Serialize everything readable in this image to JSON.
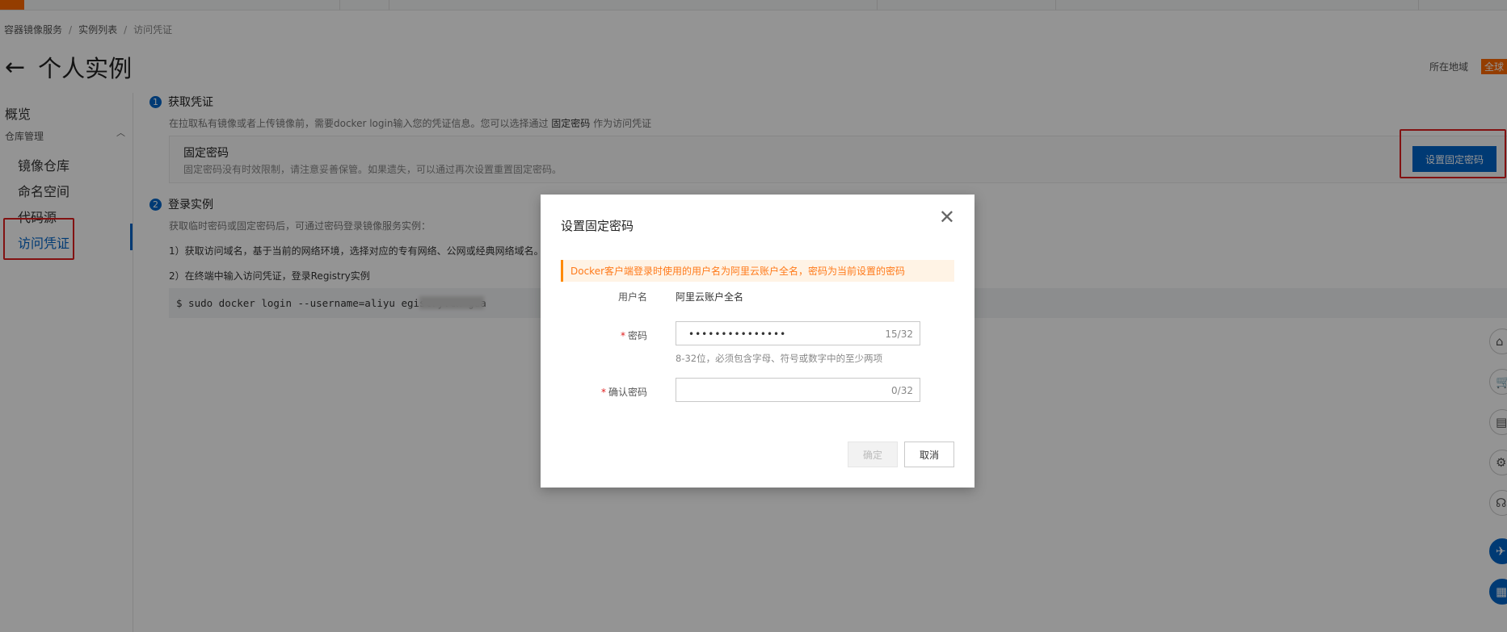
{
  "breadcrumb": [
    "容器镜像服务",
    "实例列表",
    "访问凭证"
  ],
  "page_title": "个人实例",
  "region": {
    "label": "所在地域",
    "value": "全球"
  },
  "sidebar": {
    "overview": "概览",
    "group": "仓库管理",
    "items": [
      "镜像仓库",
      "命名空间",
      "代码源",
      "访问凭证"
    ]
  },
  "step1": {
    "num": "1",
    "title": "获取凭证",
    "desc_pre": "在拉取私有镜像或者上传镜像前，需要docker login输入您的凭证信息。您可以选择通过",
    "desc_link": "固定密码",
    "desc_post": "作为访问凭证",
    "box_title": "固定密码",
    "box_desc": "固定密码没有时效限制，请注意妥善保管。如果遗失，可以通过再次设置重置固定密码。",
    "button": "设置固定密码"
  },
  "step2": {
    "num": "2",
    "title": "登录实例",
    "desc": "获取临时密码或固定密码后，可通过密码登录镜像服务实例：",
    "line1": "1）获取访问域名，基于当前的网络环境，选择对应的专有网络、公网或经典网络域名。",
    "line2": "2）在终端中输入访问凭证，登录Registry实例",
    "code": "$ sudo docker login --username=aliyu            egistry.cn-gua"
  },
  "modal": {
    "title": "设置固定密码",
    "alert": "Docker客户端登录时使用的用户名为阿里云账户全名，密码为当前设置的密码",
    "username_label": "用户名",
    "username_value": "阿里云账户全名",
    "password_label": "密码",
    "password_value": "•••••••••••••••",
    "password_count": "15/32",
    "password_hint": "8-32位，必须包含字母、符号或数字中的至少两项",
    "confirm_label": "确认密码",
    "confirm_value": "",
    "confirm_count": "0/32",
    "ok": "确定",
    "cancel": "取消"
  },
  "colors": {
    "accent": "#0064c8",
    "brand": "#ff6a00",
    "highlight_box": "#e02020",
    "alert_text": "#ff7a1a"
  },
  "icons": {
    "back": "arrow-left-icon",
    "close": "close-icon",
    "chevron": "chevron-up-icon",
    "float": [
      "home-icon",
      "cart-icon",
      "doc-icon",
      "gear-icon",
      "headset-icon",
      "rocket-icon",
      "grid-icon"
    ]
  }
}
